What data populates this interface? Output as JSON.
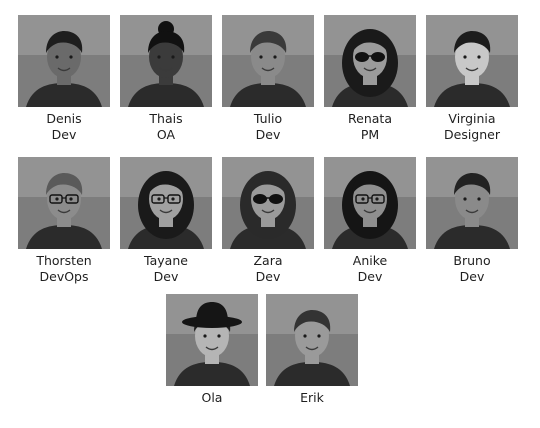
{
  "team": [
    {
      "name": "Denis",
      "role": "Dev",
      "tone": "#6a6a6a",
      "hair": "#1e1e1e",
      "accessory": "none",
      "hair_style": "short"
    },
    {
      "name": "Thais",
      "role": "OA",
      "tone": "#3b3b3b",
      "hair": "#111111",
      "accessory": "none",
      "hair_style": "bun"
    },
    {
      "name": "Tulio",
      "role": "Dev",
      "tone": "#8a8a8a",
      "hair": "#3a3a3a",
      "accessory": "none",
      "hair_style": "side"
    },
    {
      "name": "Renata",
      "role": "PM",
      "tone": "#9b9b9b",
      "hair": "#1a1a1a",
      "accessory": "sunglasses",
      "hair_style": "long"
    },
    {
      "name": "Virginia",
      "role": "Designer",
      "tone": "#c8c8c8",
      "hair": "#1c1c1c",
      "accessory": "none",
      "hair_style": "pixie"
    },
    {
      "name": "Thorsten",
      "role": "DevOps",
      "tone": "#8c8c8c",
      "hair": "#5a5a5a",
      "accessory": "glasses",
      "hair_style": "short"
    },
    {
      "name": "Tayane",
      "role": "Dev",
      "tone": "#a0a0a0",
      "hair": "#1a1a1a",
      "accessory": "glasses",
      "hair_style": "long"
    },
    {
      "name": "Zara",
      "role": "Dev",
      "tone": "#9a9a9a",
      "hair": "#2a2a2a",
      "accessory": "sunglasses",
      "hair_style": "curly"
    },
    {
      "name": "Anike",
      "role": "Dev",
      "tone": "#8f8f8f",
      "hair": "#151515",
      "accessory": "glasses",
      "hair_style": "curly"
    },
    {
      "name": "Bruno",
      "role": "Dev",
      "tone": "#8a8a8a",
      "hair": "#222222",
      "accessory": "none",
      "hair_style": "side"
    },
    {
      "name": "Ola",
      "role": "",
      "tone": "#b5b5b5",
      "hair": "#202020",
      "accessory": "hat",
      "hair_style": "short"
    },
    {
      "name": "Erik",
      "role": "",
      "tone": "#9a9a9a",
      "hair": "#333333",
      "accessory": "none",
      "hair_style": "short"
    }
  ]
}
